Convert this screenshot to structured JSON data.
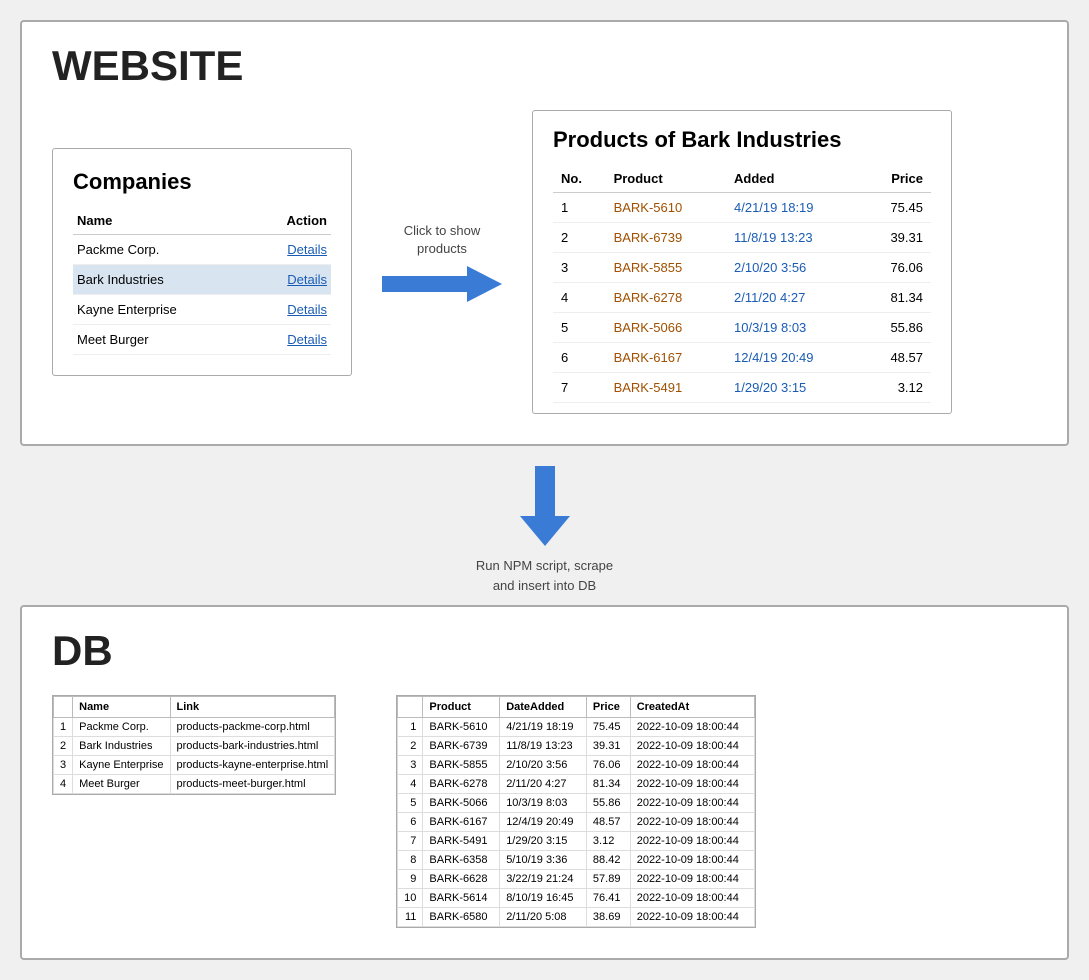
{
  "website": {
    "title": "WEBSITE",
    "companies": {
      "heading": "Companies",
      "columns": [
        "Name",
        "Action"
      ],
      "rows": [
        {
          "name": "Packme Corp.",
          "action": "Details",
          "highlighted": false
        },
        {
          "name": "Bark Industries",
          "action": "Details",
          "highlighted": true
        },
        {
          "name": "Kayne Enterprise",
          "action": "Details",
          "highlighted": false
        },
        {
          "name": "Meet Burger",
          "action": "Details",
          "highlighted": false
        }
      ]
    },
    "arrow_label": "Click to show products",
    "products": {
      "heading": "Products of Bark Industries",
      "columns": [
        "No.",
        "Product",
        "Added",
        "Price"
      ],
      "rows": [
        {
          "no": "1",
          "product": "BARK-5610",
          "added": "4/21/19 18:19",
          "price": "75.45"
        },
        {
          "no": "2",
          "product": "BARK-6739",
          "added": "11/8/19 13:23",
          "price": "39.31"
        },
        {
          "no": "3",
          "product": "BARK-5855",
          "added": "2/10/20 3:56",
          "price": "76.06"
        },
        {
          "no": "4",
          "product": "BARK-6278",
          "added": "2/11/20 4:27",
          "price": "81.34"
        },
        {
          "no": "5",
          "product": "BARK-5066",
          "added": "10/3/19 8:03",
          "price": "55.86"
        },
        {
          "no": "6",
          "product": "BARK-6167",
          "added": "12/4/19 20:49",
          "price": "48.57"
        },
        {
          "no": "7",
          "product": "BARK-5491",
          "added": "1/29/20 3:15",
          "price": "3.12"
        }
      ]
    }
  },
  "middle_arrow": {
    "label": "Run NPM script, scrape\nand insert into DB"
  },
  "db": {
    "title": "DB",
    "companies": {
      "columns": [
        "Name",
        "Link"
      ],
      "rows": [
        {
          "no": "1",
          "name": "Packme Corp.",
          "link": "products-packme-corp.html"
        },
        {
          "no": "2",
          "name": "Bark Industries",
          "link": "products-bark-industries.html"
        },
        {
          "no": "3",
          "name": "Kayne Enterprise",
          "link": "products-kayne-enterprise.html"
        },
        {
          "no": "4",
          "name": "Meet Burger",
          "link": "products-meet-burger.html"
        }
      ]
    },
    "products": {
      "columns": [
        "Product",
        "DateAdded",
        "Price",
        "CreatedAt"
      ],
      "rows": [
        {
          "no": "1",
          "product": "BARK-5610",
          "date": "4/21/19 18:19",
          "price": "75.45",
          "created": "2022-10-09 18:00:44"
        },
        {
          "no": "2",
          "product": "BARK-6739",
          "date": "11/8/19 13:23",
          "price": "39.31",
          "created": "2022-10-09 18:00:44"
        },
        {
          "no": "3",
          "product": "BARK-5855",
          "date": "2/10/20 3:56",
          "price": "76.06",
          "created": "2022-10-09 18:00:44"
        },
        {
          "no": "4",
          "product": "BARK-6278",
          "date": "2/11/20 4:27",
          "price": "81.34",
          "created": "2022-10-09 18:00:44"
        },
        {
          "no": "5",
          "product": "BARK-5066",
          "date": "10/3/19 8:03",
          "price": "55.86",
          "created": "2022-10-09 18:00:44"
        },
        {
          "no": "6",
          "product": "BARK-6167",
          "date": "12/4/19 20:49",
          "price": "48.57",
          "created": "2022-10-09 18:00:44"
        },
        {
          "no": "7",
          "product": "BARK-5491",
          "date": "1/29/20 3:15",
          "price": "3.12",
          "created": "2022-10-09 18:00:44"
        },
        {
          "no": "8",
          "product": "BARK-6358",
          "date": "5/10/19 3:36",
          "price": "88.42",
          "created": "2022-10-09 18:00:44"
        },
        {
          "no": "9",
          "product": "BARK-6628",
          "date": "3/22/19 21:24",
          "price": "57.89",
          "created": "2022-10-09 18:00:44"
        },
        {
          "no": "10",
          "product": "BARK-5614",
          "date": "8/10/19 16:45",
          "price": "76.41",
          "created": "2022-10-09 18:00:44"
        },
        {
          "no": "11",
          "product": "BARK-6580",
          "date": "2/11/20 5:08",
          "price": "38.69",
          "created": "2022-10-09 18:00:44"
        }
      ]
    }
  }
}
